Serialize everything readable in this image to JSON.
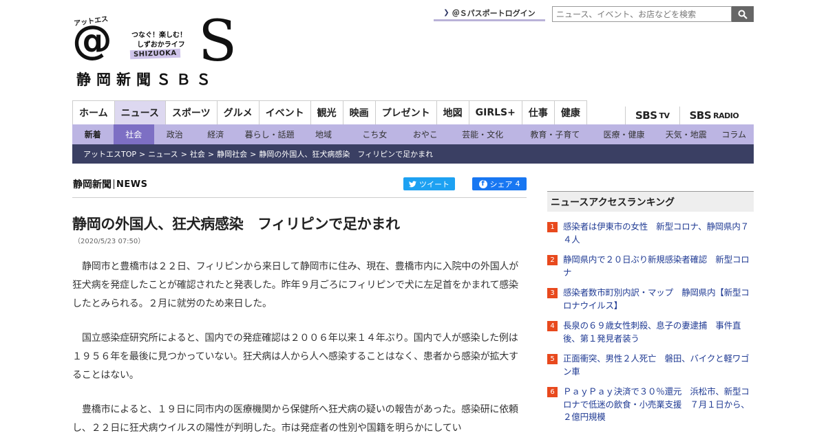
{
  "logo": {
    "at_kana": "アットエス",
    "at_symbol": "@",
    "tagline_1": "つなぐ！楽しむ！",
    "tagline_2": "しずおかライフ",
    "shizuoka": "SHIZUOKA",
    "big_s": "S",
    "paper_name": "静岡新聞ＳＢＳ"
  },
  "header": {
    "passport_login": "＠Ｓパスポートログイン",
    "search_placeholder": "ニュース、イベント、お店などを検索"
  },
  "main_nav": [
    {
      "label": "ホーム"
    },
    {
      "label": "ニュース",
      "active": true
    },
    {
      "label": "スポーツ"
    },
    {
      "label": "グルメ"
    },
    {
      "label": "イベント"
    },
    {
      "label": "観光"
    },
    {
      "label": "映画"
    },
    {
      "label": "プレゼント"
    },
    {
      "label": "地図"
    },
    {
      "label": "GIRLS+"
    },
    {
      "label": "仕事"
    },
    {
      "label": "健康"
    }
  ],
  "ext_nav": {
    "tv": "SBS",
    "tv_suffix": "TV",
    "radio": "SBS",
    "radio_suffix": "RADIO"
  },
  "sub_nav": [
    {
      "label": "新着"
    },
    {
      "label": "社会"
    },
    {
      "label": "政治"
    },
    {
      "label": "経済"
    },
    {
      "label": "暮らし・話題"
    },
    {
      "label": "地域"
    },
    {
      "label": "こち女"
    },
    {
      "label": "おやこ"
    },
    {
      "label": "芸能・文化"
    },
    {
      "label": "教育・子育て"
    },
    {
      "label": "医療・健康"
    },
    {
      "label": "天気・地震"
    },
    {
      "label": "コラム"
    }
  ],
  "breadcrumb": {
    "items": [
      "アットエスTOP",
      "ニュース",
      "社会",
      "静岡社会",
      "静岡の外国人、狂犬病感染　フィリピンで足かまれ"
    ],
    "separator": ">"
  },
  "article": {
    "brand_jp": "静岡新聞",
    "brand_en": "NEWS",
    "tweet_label": "ツイート",
    "share_label": "シェア",
    "share_count": "4",
    "title": "静岡の外国人、狂犬病感染　フィリピンで足かまれ",
    "date": "（2020/5/23 07:50）",
    "paragraphs": [
      "静岡市と豊橋市は２２日、フィリピンから来日して静岡市に住み、現在、豊橋市内に入院中の外国人が狂犬病を発症したことが確認されたと発表した。昨年９月ごろにフィリピンで犬に左足首をかまれて感染したとみられる。２月に就労のため来日した。",
      "国立感染症研究所によると、国内での発症確認は２００６年以来１４年ぶり。国内で人が感染した例は１９５６年を最後に見つかっていない。狂犬病は人から人へ感染することはなく、患者から感染が拡大することはない。",
      "豊橋市によると、１９日に同市内の医療機関から保健所へ狂犬病の疑いの報告があった。感染研に依頼し、２２日に狂犬病ウイルスの陽性が判明した。市は発症者の性別や国籍を明らかにしてい"
    ]
  },
  "ranking": {
    "heading": "ニュースアクセスランキング",
    "items": [
      {
        "rank": "1",
        "text": "感染者は伊東市の女性　新型コロナ、静岡県内７４人"
      },
      {
        "rank": "2",
        "text": "静岡県内で２０日ぶり新規感染者確認　新型コロナ"
      },
      {
        "rank": "3",
        "text": "感染者数市町別内訳・マップ　静岡県内【新型コロナウイルス】"
      },
      {
        "rank": "4",
        "text": "長泉の６９歳女性刺殺、息子の妻逮捕　事件直後、第１発見者装う"
      },
      {
        "rank": "5",
        "text": "正面衝突、男性２人死亡　磐田、バイクと軽ワゴン車"
      },
      {
        "rank": "6",
        "text": "ＰａｙＰａｙ決済で３０％還元　浜松市、新型コロナで低迷の飲食・小売業支援　７月１日から、２億円規模"
      }
    ]
  },
  "colors": {
    "accent_purple": "#bcb5e3",
    "active_purple": "#7d6fc4",
    "breadcrumb_bg": "#3a3f63",
    "twitter": "#1da1f2",
    "facebook": "#1877f2",
    "rank_badge": "#e8491d",
    "link_blue": "#1f3a93"
  }
}
